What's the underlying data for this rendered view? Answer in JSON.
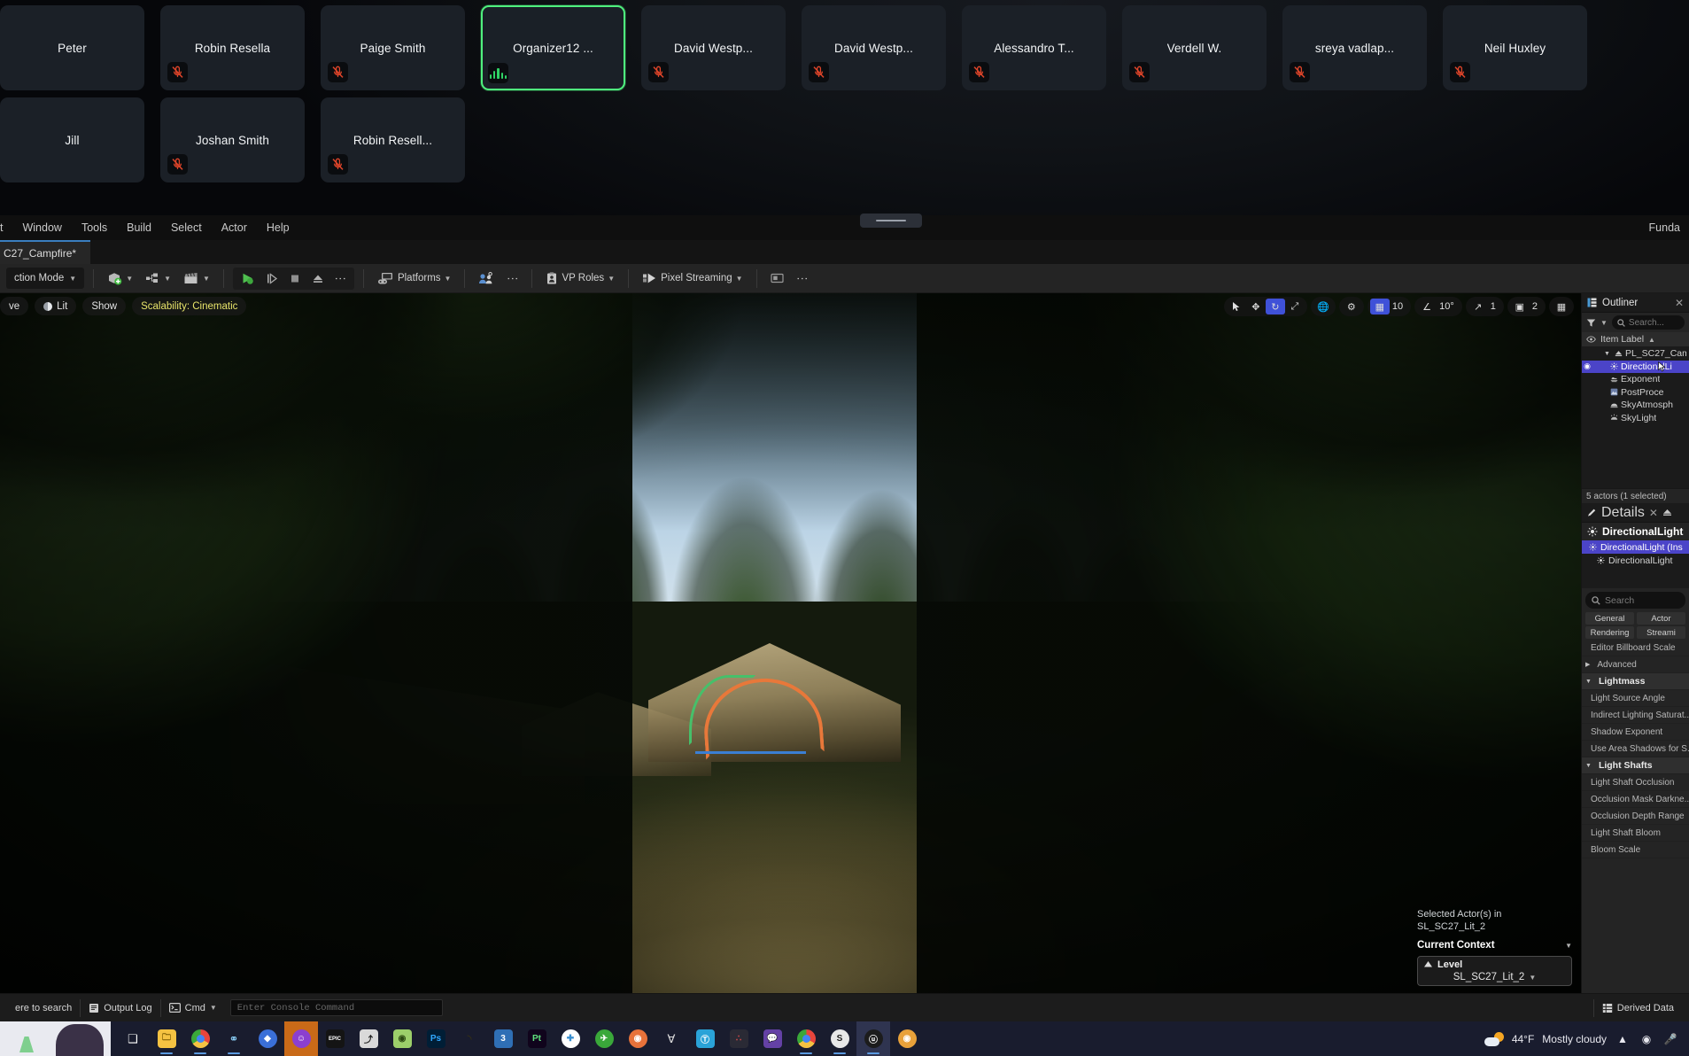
{
  "video_call": {
    "row1": [
      {
        "name": "Peter",
        "mic": "none"
      },
      {
        "name": "Robin Resella",
        "mic": "muted"
      },
      {
        "name": "Paige Smith",
        "mic": "muted"
      },
      {
        "name": "Organizer12 ...",
        "mic": "speaking",
        "active": true
      },
      {
        "name": "David Westp...",
        "mic": "muted"
      },
      {
        "name": "David Westp...",
        "mic": "muted"
      },
      {
        "name": "Alessandro T...",
        "mic": "muted"
      },
      {
        "name": "Verdell W.",
        "mic": "muted"
      },
      {
        "name": "sreya vadlap...",
        "mic": "muted"
      },
      {
        "name": "Neil Huxley",
        "mic": "muted"
      }
    ],
    "row2": [
      {
        "name": "Jill",
        "mic": "none"
      },
      {
        "name": "Joshan Smith",
        "mic": "muted"
      },
      {
        "name": "Robin Resell...",
        "mic": "muted"
      }
    ],
    "accent_active": "#4ff07e",
    "mic_muted_color": "#e0452a"
  },
  "editor": {
    "menubar": [
      "t",
      "Window",
      "Tools",
      "Build",
      "Select",
      "Actor",
      "Help"
    ],
    "menubar_right": "Funda",
    "level_tab": "C27_Campfire*",
    "toolbar": {
      "selection_mode": "ction Mode",
      "create_label": "create-actor",
      "blueprint_label": "blueprints",
      "cinematics_label": "cinematics",
      "platforms": "Platforms",
      "vp_roles": "VP Roles",
      "pixel_streaming": "Pixel Streaming"
    },
    "viewport_left_pills": {
      "perspective": "ve",
      "lit": "Lit",
      "show": "Show",
      "scalability": "Scalability: Cinematic"
    },
    "viewport_right": {
      "grid_snap": "10",
      "rotation_snap": "10°",
      "scale_snap": "1",
      "camera_speed": "2"
    },
    "actor_overlay": {
      "line1": "Selected Actor(s) in",
      "line2": "SL_SC27_Lit_2",
      "context_label": "Current Context",
      "level_label": "Level",
      "level_value": "SL_SC27_Lit_2"
    },
    "outliner": {
      "title": "Outliner",
      "search_placeholder": "Search...",
      "column_header": "Item Label",
      "items": [
        {
          "label": "PL_SC27_Cam",
          "depth": 1,
          "icon": "level-icon",
          "selected": false,
          "eye": false,
          "expand": true
        },
        {
          "label": "DirectionalLi",
          "depth": 2,
          "icon": "directional-light-icon",
          "selected": true,
          "eye": true
        },
        {
          "label": "Exponent",
          "depth": 2,
          "icon": "fog-icon",
          "selected": false,
          "eye": false
        },
        {
          "label": "PostProce",
          "depth": 2,
          "icon": "postprocess-icon",
          "selected": false,
          "eye": false
        },
        {
          "label": "SkyAtmosph",
          "depth": 2,
          "icon": "sky-atmosphere-icon",
          "selected": false,
          "eye": false
        },
        {
          "label": "SkyLight",
          "depth": 2,
          "icon": "skylight-icon",
          "selected": false,
          "eye": false
        }
      ],
      "status": "5 actors (1 selected)"
    },
    "details": {
      "title": "Details",
      "actor_name": "DirectionalLight",
      "tree": [
        {
          "label": "DirectionalLight (Ins",
          "depth": 0,
          "selected": true
        },
        {
          "label": "DirectionalLight",
          "depth": 1,
          "selected": false
        }
      ],
      "search_placeholder": "Search",
      "filter_chips": [
        "General",
        "Actor",
        "Rendering",
        "Streami"
      ],
      "properties": [
        {
          "label": "Editor Billboard Scale",
          "type": "prop"
        },
        {
          "label": "Advanced",
          "type": "adv"
        },
        {
          "label": "Lightmass",
          "type": "cat"
        },
        {
          "label": "Light Source Angle",
          "type": "prop"
        },
        {
          "label": "Indirect Lighting Saturat...",
          "type": "prop"
        },
        {
          "label": "Shadow Exponent",
          "type": "prop"
        },
        {
          "label": "Use Area Shadows for S...",
          "type": "prop"
        },
        {
          "label": "Light Shafts",
          "type": "cat"
        },
        {
          "label": "Light Shaft Occlusion",
          "type": "prop"
        },
        {
          "label": "Occlusion Mask Darkne...",
          "type": "prop"
        },
        {
          "label": "Occlusion Depth Range",
          "type": "prop"
        },
        {
          "label": "Light Shaft Bloom",
          "type": "prop"
        },
        {
          "label": "Bloom Scale",
          "type": "prop"
        }
      ]
    },
    "statusbar": {
      "search_hint": "ere to search",
      "output_log": "Output Log",
      "cmd": "Cmd",
      "console_placeholder": "Enter Console Command",
      "derived_data": "Derived Data"
    }
  },
  "taskbar": {
    "apps": [
      {
        "name": "task-view",
        "glyph": "❑",
        "color": "#2a2e44",
        "text": "#ffffff",
        "shape": "none",
        "running": false
      },
      {
        "name": "file-explorer",
        "glyph": "🗀",
        "color": "#f5c242",
        "text": "#7a5a00",
        "shape": "sq",
        "running": true
      },
      {
        "name": "google-chrome",
        "glyph": "",
        "color": "#e8453c",
        "text": "#ffffff",
        "shape": "circ",
        "running": true
      },
      {
        "name": "steam",
        "glyph": "⚭",
        "color": "#1b2838",
        "text": "#8fd6ff",
        "shape": "none",
        "running": true
      },
      {
        "name": "discord",
        "glyph": "◆",
        "color": "#3a6fd8",
        "text": "#ffffff",
        "shape": "circ",
        "running": false
      },
      {
        "name": "party-app",
        "glyph": "☺",
        "color": "#8b3fd0",
        "text": "#ffffff",
        "shape": "circ",
        "running": false,
        "highlight": true
      },
      {
        "name": "epic-games",
        "glyph": "EPIC",
        "color": "#141414",
        "text": "#ffffff",
        "shape": "sq",
        "running": false
      },
      {
        "name": "autodesk-maya",
        "glyph": "⤴",
        "color": "#d9d9d9",
        "text": "#222222",
        "shape": "sq",
        "running": false
      },
      {
        "name": "substance-designer",
        "glyph": "◉",
        "color": "#9ccf6a",
        "text": "#2c4a12",
        "shape": "sq",
        "running": false
      },
      {
        "name": "photoshop",
        "glyph": "Ps",
        "color": "#001e36",
        "text": "#31a8ff",
        "shape": "sq",
        "running": false
      },
      {
        "name": "nuke",
        "glyph": "◝",
        "color": "#c7b23a",
        "text": "#3a3410",
        "shape": "none",
        "running": false
      },
      {
        "name": "3ds-max",
        "glyph": "3",
        "color": "#2f6fb5",
        "text": "#ffffff",
        "shape": "sq",
        "running": false
      },
      {
        "name": "premiere-pro",
        "glyph": "Pt",
        "color": "#10041c",
        "text": "#5fe07d",
        "shape": "sq",
        "running": false
      },
      {
        "name": "health-app",
        "glyph": "✚",
        "color": "#ffffff",
        "text": "#3a8fd0",
        "shape": "circ",
        "running": false
      },
      {
        "name": "green-tool",
        "glyph": "✈",
        "color": "#3aa83a",
        "text": "#ffffff",
        "shape": "circ",
        "running": false
      },
      {
        "name": "blender",
        "glyph": "◉",
        "color": "#e8723a",
        "text": "#ffffff",
        "shape": "circ",
        "running": false
      },
      {
        "name": "perforce",
        "glyph": "∀",
        "color": "#1c1c1c",
        "text": "#e0e0e0",
        "shape": "none",
        "running": false
      },
      {
        "name": "teams",
        "glyph": "Ⓣ",
        "color": "#2aa3d8",
        "text": "#ffffff",
        "shape": "sq",
        "running": false
      },
      {
        "name": "resolve",
        "glyph": "∴",
        "color": "#2a2a35",
        "text": "#d84a4a",
        "shape": "sq",
        "running": false
      },
      {
        "name": "twitch",
        "glyph": "💬",
        "color": "#6441a5",
        "text": "#ffffff",
        "shape": "sq",
        "running": false
      },
      {
        "name": "chrome-2",
        "glyph": "",
        "color": "#e8453c",
        "text": "#ffffff",
        "shape": "circ",
        "running": true
      },
      {
        "name": "shotgrid",
        "glyph": "S",
        "color": "#e8e8e8",
        "text": "#1c1c1c",
        "shape": "circ",
        "running": true
      },
      {
        "name": "unreal-engine",
        "glyph": "ⓤ",
        "color": "#1c1c1c",
        "text": "#ffffff",
        "shape": "circ",
        "running": true,
        "highlight2": true
      },
      {
        "name": "blender-2",
        "glyph": "◉",
        "color": "#e8a13a",
        "text": "#ffffff",
        "shape": "circ",
        "running": false
      }
    ],
    "weather_temp": "44°F",
    "weather_desc": "Mostly cloudy",
    "tray": [
      "chevron-up-icon",
      "camera-icon",
      "microphone-icon"
    ]
  }
}
